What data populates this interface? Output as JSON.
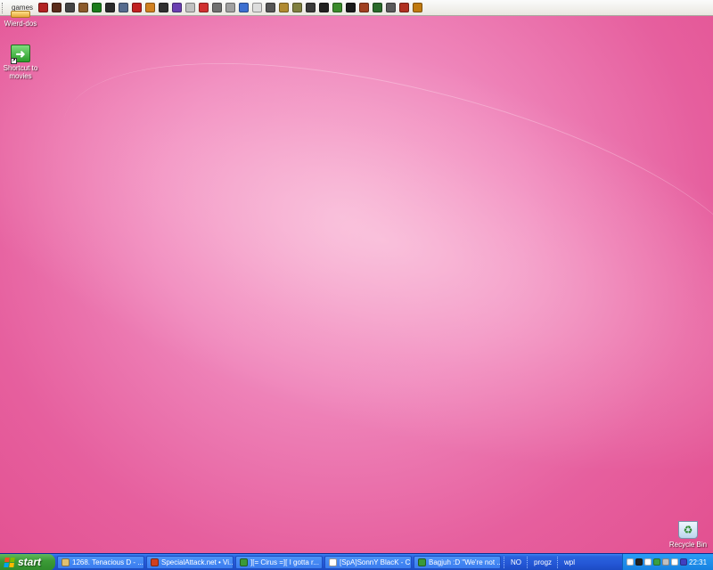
{
  "top_toolbar": {
    "label": "games",
    "icons": [
      {
        "name": "game-1-icon",
        "color": "#b22222"
      },
      {
        "name": "game-2-icon",
        "color": "#5a2b1a"
      },
      {
        "name": "game-3-icon",
        "color": "#444444"
      },
      {
        "name": "game-4-icon",
        "color": "#8b5a2b"
      },
      {
        "name": "game-5-icon",
        "color": "#1a7a1a"
      },
      {
        "name": "game-6-icon",
        "color": "#2a2a2a"
      },
      {
        "name": "game-7-icon",
        "color": "#556b8e"
      },
      {
        "name": "game-8-icon",
        "color": "#c02020"
      },
      {
        "name": "game-9-icon",
        "color": "#d08020"
      },
      {
        "name": "game-10-icon",
        "color": "#303030"
      },
      {
        "name": "game-11-icon",
        "color": "#6a3fb0"
      },
      {
        "name": "game-12-icon",
        "color": "#c0c0c0"
      },
      {
        "name": "game-13-icon",
        "color": "#d03030"
      },
      {
        "name": "game-14-icon",
        "color": "#707070"
      },
      {
        "name": "game-15-icon",
        "color": "#a0a0a0"
      },
      {
        "name": "game-16-icon",
        "color": "#3c6fd0"
      },
      {
        "name": "game-17-icon",
        "color": "#dddddd"
      },
      {
        "name": "game-18-icon",
        "color": "#555555"
      },
      {
        "name": "game-19-icon",
        "color": "#b08a30"
      },
      {
        "name": "game-20-icon",
        "color": "#808040"
      },
      {
        "name": "game-21-icon",
        "color": "#3a3a3a"
      },
      {
        "name": "game-22-icon",
        "color": "#202020"
      },
      {
        "name": "game-23-icon",
        "color": "#3a8a2a"
      },
      {
        "name": "game-24-icon",
        "color": "#1a1a1a"
      },
      {
        "name": "game-25-icon",
        "color": "#a04020"
      },
      {
        "name": "game-26-icon",
        "color": "#2a6a2a"
      },
      {
        "name": "game-27-icon",
        "color": "#5a5a5a"
      },
      {
        "name": "game-28-icon",
        "color": "#b03020"
      },
      {
        "name": "game-29-icon",
        "color": "#c07a10"
      }
    ]
  },
  "desktop": {
    "icons": [
      {
        "label": "Wierd-dos"
      },
      {
        "label": "Shortcut to movies"
      },
      {
        "label": "Recycle Bin"
      }
    ]
  },
  "taskbar": {
    "start_label": "start",
    "tasks": [
      {
        "label": "1268. Tenacious D - ...",
        "icon_color": "#e0c070"
      },
      {
        "label": "SpecialAttack.net • Vi...",
        "icon_color": "#d04020"
      },
      {
        "label": "][= Cirus =][ I gotta r...",
        "icon_color": "#3a9a3a"
      },
      {
        "label": "[SpA]SonnY BlacK - C...",
        "icon_color": "#ffffff"
      },
      {
        "label": "Bagjuh :D \"We're not ...",
        "icon_color": "#3a9a3a"
      }
    ],
    "quick_toolbars": [
      "NO",
      "progz",
      "wpl"
    ],
    "tray_icon_colors": [
      "#ffffff",
      "#222222",
      "#ffffff",
      "#3aa040",
      "#c0c0c0",
      "#ffffff",
      "#4040c0"
    ],
    "clock": "22:31"
  }
}
